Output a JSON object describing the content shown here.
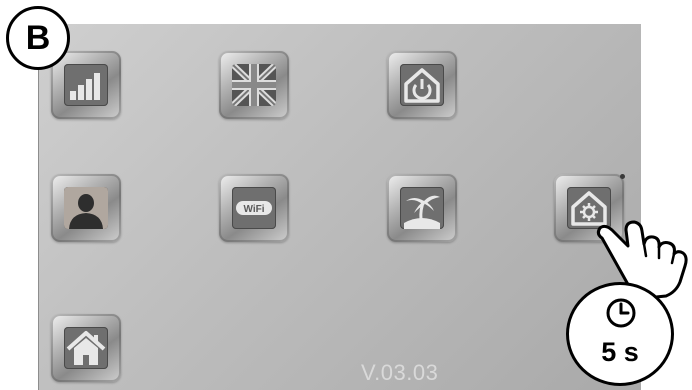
{
  "corner_label": "B",
  "grid": {
    "row1": [
      {
        "icon": "signal-bars-icon"
      },
      {
        "icon": "uk-flag-icon"
      },
      {
        "icon": "home-power-icon"
      }
    ],
    "row2": [
      {
        "icon": "user-icon"
      },
      {
        "icon": "wifi-icon",
        "label": "WiFi"
      },
      {
        "icon": "island-icon"
      },
      {
        "icon": "home-settings-icon"
      }
    ],
    "row3": [
      {
        "icon": "home-icon"
      }
    ]
  },
  "version": "V.03.03",
  "hold": {
    "duration": "5 s",
    "gesture_icon": "pointing-hand-icon",
    "timer_icon": "clock-icon"
  },
  "colors": {
    "screen": "#bdbdbd",
    "icon_bg": "#6f6f6f",
    "icon_glyph": "#e8e8e8"
  }
}
